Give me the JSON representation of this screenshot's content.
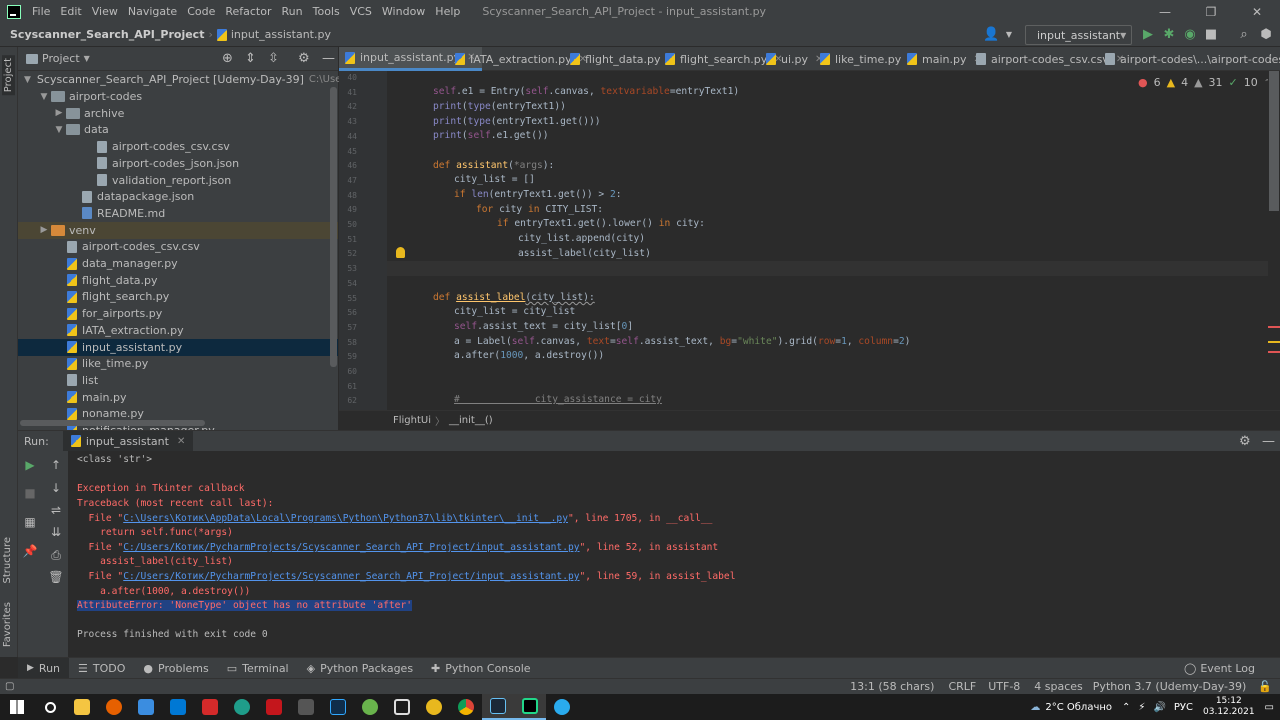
{
  "menu": {
    "items": [
      "File",
      "Edit",
      "View",
      "Navigate",
      "Code",
      "Refactor",
      "Run",
      "Tools",
      "VCS",
      "Window",
      "Help"
    ],
    "title": "Scyscanner_Search_API_Project - input_assistant.py"
  },
  "window_controls": {
    "minimize": "—",
    "maximize": "❐",
    "close": "✕"
  },
  "navbar": {
    "project": "Scyscanner_Search_API_Project",
    "file": "input_assistant.py",
    "run_config": "input_assistant"
  },
  "sidebar": {
    "project_tab": "Project",
    "structure_tab": "Structure",
    "favorites_tab": "Favorites"
  },
  "project_panel": {
    "title": "Project",
    "root": "Scyscanner_Search_API_Project [Udemy-Day-39]",
    "root_path": "C:\\Users\\Котик\\P",
    "tree": [
      {
        "label": "airport-codes",
        "type": "folder",
        "depth": 1,
        "open": true
      },
      {
        "label": "archive",
        "type": "folder",
        "depth": 2,
        "open": false
      },
      {
        "label": "data",
        "type": "folder",
        "depth": 2,
        "open": true
      },
      {
        "label": "airport-codes_csv.csv",
        "type": "csv",
        "depth": 4
      },
      {
        "label": "airport-codes_json.json",
        "type": "json",
        "depth": 4
      },
      {
        "label": "validation_report.json",
        "type": "json",
        "depth": 4
      },
      {
        "label": "datapackage.json",
        "type": "json",
        "depth": 3
      },
      {
        "label": "README.md",
        "type": "md",
        "depth": 3
      },
      {
        "label": "venv",
        "type": "folder-orange",
        "depth": 1,
        "open": false
      },
      {
        "label": "airport-codes_csv.csv",
        "type": "csv",
        "depth": 2
      },
      {
        "label": "data_manager.py",
        "type": "py",
        "depth": 2
      },
      {
        "label": "flight_data.py",
        "type": "py",
        "depth": 2
      },
      {
        "label": "flight_search.py",
        "type": "py",
        "depth": 2
      },
      {
        "label": "for_airports.py",
        "type": "py",
        "depth": 2
      },
      {
        "label": "IATA_extraction.py",
        "type": "py",
        "depth": 2
      },
      {
        "label": "input_assistant.py",
        "type": "py",
        "depth": 2,
        "selected": true
      },
      {
        "label": "like_time.py",
        "type": "py",
        "depth": 2
      },
      {
        "label": "list",
        "type": "txt",
        "depth": 2
      },
      {
        "label": "main.py",
        "type": "py",
        "depth": 2
      },
      {
        "label": "noname.py",
        "type": "py",
        "depth": 2
      },
      {
        "label": "notification_manager.py",
        "type": "py",
        "depth": 2
      }
    ]
  },
  "editor_tabs": [
    {
      "label": "input_assistant.py",
      "active": true
    },
    {
      "label": "IATA_extraction.py"
    },
    {
      "label": "flight_data.py"
    },
    {
      "label": "flight_search.py"
    },
    {
      "label": "ui.py"
    },
    {
      "label": "like_time.py"
    },
    {
      "label": "main.py"
    },
    {
      "label": "airport-codes_csv.csv"
    },
    {
      "label": "airport-codes\\...\\airport-codes_csv.csv"
    }
  ],
  "inspections": {
    "errors": "6",
    "warnings": "4",
    "weak": "31",
    "ok": "10"
  },
  "editor_breadcrumb": {
    "cls": "FlightUi",
    "method": "__init__()"
  },
  "code": {
    "line_numbers": [
      "40",
      "41",
      "42",
      "43",
      "44",
      "45",
      "46",
      "47",
      "48",
      "49",
      "50",
      "51",
      "52",
      "53",
      "54",
      "55",
      "56",
      "57",
      "58",
      "59",
      "60",
      "61",
      "62"
    ],
    "l40": "",
    "l41_a": "self",
    "l41_b": ".e1 = Entry(",
    "l41_c": "self",
    "l41_d": ".canvas, ",
    "l41_e": "textvariable",
    "l41_f": "=entryText1)",
    "l42_a": "print",
    "l42_b": "(",
    "l42_c": "type",
    "l42_d": "(entryText1))",
    "l43_a": "print",
    "l43_b": "(",
    "l43_c": "type",
    "l43_d": "(entryText1.get()))",
    "l44_a": "print",
    "l44_b": "(",
    "l44_c": "self",
    "l44_d": ".e1.get())",
    "l46_a": "def ",
    "l46_b": "assistant",
    "l46_c": "(",
    "l46_d": "*args",
    "l46_e": "):",
    "l47": "city_list = []",
    "l48_a": "if ",
    "l48_b": "len",
    "l48_c": "(entryText1.get()) > ",
    "l48_d": "2",
    "l48_e": ":",
    "l49_a": "for ",
    "l49_b": "city ",
    "l49_c": "in ",
    "l49_d": "CITY_LIST:",
    "l50_a": "if ",
    "l50_b": "entryText1.get().lower() ",
    "l50_c": "in ",
    "l50_d": "city:",
    "l51": "city_list.append(city)",
    "l52": "assist_label(city_list)",
    "l55_a": "def ",
    "l55_b": "assist_label",
    "l55_c": "(city_list):",
    "l56": "city_list = city_list",
    "l57_a": "self",
    "l57_b": ".assist_text = city_list[",
    "l57_c": "0",
    "l57_d": "]",
    "l58_a": "a = Label(",
    "l58_b": "self",
    "l58_c": ".canvas, ",
    "l58_d": "text",
    "l58_e": "=",
    "l58_f": "self",
    "l58_g": ".assist_text, ",
    "l58_h": "bg",
    "l58_i": "=",
    "l58_j": "\"white\"",
    "l58_k": ").grid(",
    "l58_l": "row",
    "l58_m": "=",
    "l58_n": "1",
    "l58_o": ", ",
    "l58_p": "column",
    "l58_q": "=",
    "l58_r": "2",
    "l58_s": ")",
    "l59_a": "a.after(",
    "l59_b": "1000",
    "l59_c": ", a.destroy())",
    "l62": "#             city_assistance = city"
  },
  "run": {
    "label": "Run:",
    "tab": "input_assistant",
    "console": {
      "l1": "<class 'str'>",
      "l2": "Exception in Tkinter callback",
      "l3": "Traceback (most recent call last):",
      "l4_a": "  File \"",
      "l4_link": "C:\\Users\\Котик\\AppData\\Local\\Programs\\Python\\Python37\\lib\\tkinter\\__init__.py",
      "l4_b": "\", line 1705, in __call__",
      "l5": "    return self.func(*args)",
      "l6_a": "  File \"",
      "l6_link": "C:/Users/Котик/PycharmProjects/Scyscanner_Search_API_Project/input_assistant.py",
      "l6_b": "\", line 52, in assistant",
      "l7": "    assist_label(city_list)",
      "l8_a": "  File \"",
      "l8_link": "C:/Users/Котик/PycharmProjects/Scyscanner_Search_API_Project/input_assistant.py",
      "l8_b": "\", line 59, in assist_label",
      "l9": "    a.after(1000, a.destroy())",
      "l10": "AttributeError: 'NoneType' object has no attribute 'after'",
      "l11": "Process finished with exit code 0"
    }
  },
  "tool_windows": [
    "Run",
    "TODO",
    "Problems",
    "Terminal",
    "Python Packages",
    "Python Console"
  ],
  "event_log": "Event Log",
  "status": {
    "position": "13:1 (58 chars)",
    "line_sep": "CRLF",
    "encoding": "UTF-8",
    "indent": "4 spaces",
    "interpreter": "Python 3.7 (Udemy-Day-39)"
  },
  "taskbar": {
    "weather": "2°C  Облачно",
    "lang": "РУС",
    "time": "15:12",
    "date": "03.12.2021"
  },
  "colors": {
    "accent": "#4a88c7",
    "error": "#ff6b68",
    "link": "#5394ec",
    "highlight": "#214283"
  }
}
